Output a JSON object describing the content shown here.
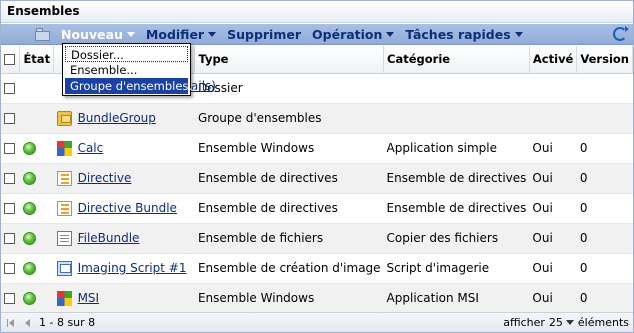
{
  "panel": {
    "title": "Ensembles"
  },
  "toolbar": {
    "items": [
      {
        "label": "Nouveau"
      },
      {
        "label": "Modifier"
      },
      {
        "label": "Supprimer"
      },
      {
        "label": "Opération"
      },
      {
        "label": "Tâches rapides"
      }
    ]
  },
  "nouveau_menu": {
    "items": [
      "Dossier...",
      "Ensemble...",
      "Groupe d'ensembles..."
    ]
  },
  "table": {
    "columns": {
      "state": "État",
      "type": "Type",
      "category": "Catégorie",
      "active": "Activé",
      "version": "Version"
    },
    "rows": [
      {
        "name": "ails)",
        "type": "Dossier",
        "category": "",
        "active": "",
        "version": "",
        "status": "",
        "icon": ""
      },
      {
        "name": "BundleGroup",
        "type": "Groupe d'ensembles",
        "category": "",
        "active": "",
        "version": "",
        "status": "",
        "icon": "bundlegroup-icon"
      },
      {
        "name": "Calc",
        "type": "Ensemble Windows",
        "category": "Application simple",
        "active": "Oui",
        "version": "0",
        "status": "green",
        "icon": "windows-bundle-icon"
      },
      {
        "name": "Directive",
        "type": "Ensemble de directives",
        "category": "Ensemble de directives",
        "active": "Oui",
        "version": "0",
        "status": "green",
        "icon": "directive-bundle-icon"
      },
      {
        "name": "Directive Bundle",
        "type": "Ensemble de directives",
        "category": "Ensemble de directives",
        "active": "Oui",
        "version": "0",
        "status": "green",
        "icon": "directive-bundle-icon"
      },
      {
        "name": "FileBundle",
        "type": "Ensemble de fichiers",
        "category": "Copier des fichiers",
        "active": "Oui",
        "version": "0",
        "status": "green",
        "icon": "file-bundle-icon"
      },
      {
        "name": "Imaging Script #1",
        "type": "Ensemble de création d'image",
        "category": "Script d'imagerie",
        "active": "Oui",
        "version": "0",
        "status": "green",
        "icon": "imaging-bundle-icon"
      },
      {
        "name": "MSI",
        "type": "Ensemble Windows",
        "category": "Application MSI",
        "active": "Oui",
        "version": "0",
        "status": "green",
        "icon": "windows-bundle-icon"
      }
    ]
  },
  "footer": {
    "range": "1 - 8 sur 8",
    "show_label": "afficher",
    "page_size": "25",
    "items_label": "éléments"
  }
}
